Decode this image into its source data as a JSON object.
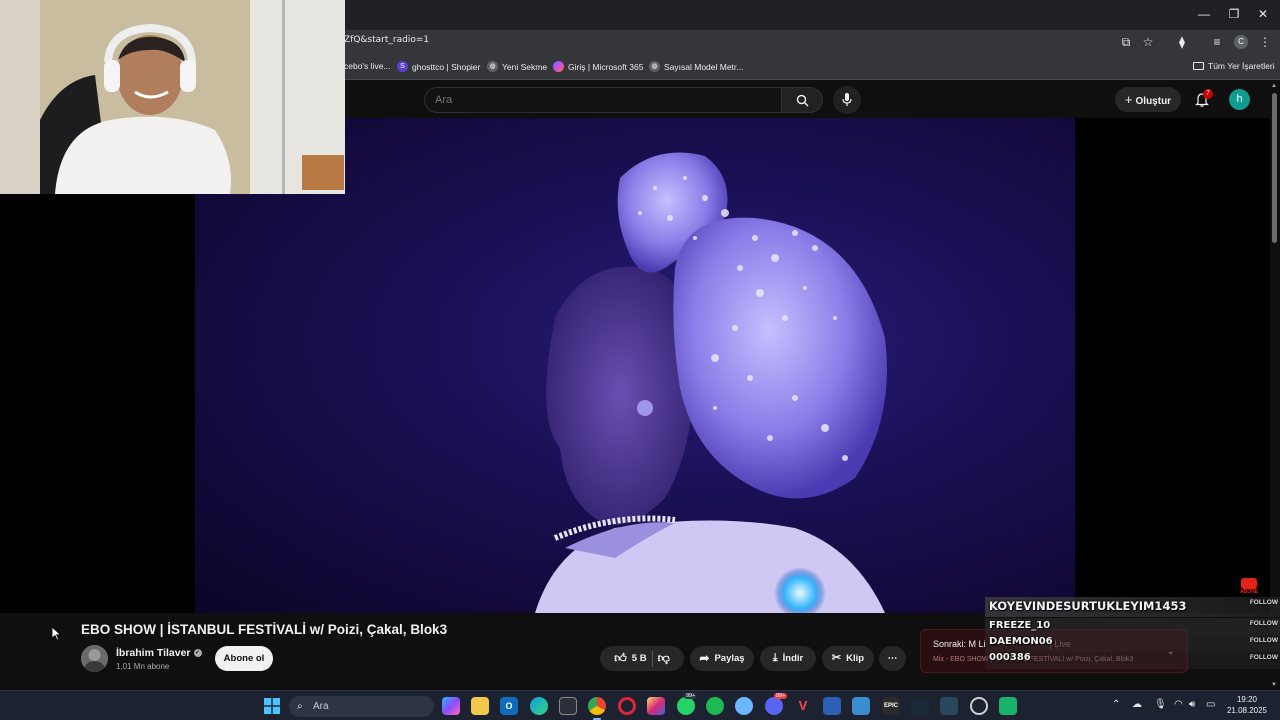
{
  "browser": {
    "url_fragment": "ZfQ&start_radio=1",
    "window_controls": [
      "minimize",
      "maximize",
      "close"
    ],
    "profile_initial": "C"
  },
  "bookmarks": {
    "items": [
      {
        "label": "cebo's live...",
        "icon": "page-icon"
      },
      {
        "label": "ghosttco | Shopier",
        "icon": "shopier-icon",
        "badge": "S"
      },
      {
        "label": "Yeni Sekme",
        "icon": "globe-icon"
      },
      {
        "label": "Giriş | Microsoft 365",
        "icon": "microsoft-365-icon"
      },
      {
        "label": "Sayısal Model Metr...",
        "icon": "globe-icon"
      }
    ],
    "all_bookmarks": "Tüm Yer İşaretleri"
  },
  "youtube": {
    "search_placeholder": "Ara",
    "create_label": "Oluştur",
    "notification_count": "7",
    "avatar_initial": "h"
  },
  "video": {
    "title": "EBO SHOW | İSTANBUL FESTİVALİ w/ Poizi, Çakal, Blok3",
    "channel_name": "İbrahim Tilaver",
    "subscribers": "1,01 Mn abone",
    "subscribe_label": "Abone ol",
    "like_count": "5 B",
    "share_label": "Paylaş",
    "download_label": "İndir",
    "clip_label": "Klip",
    "more_label": "⋯",
    "end_badge": "ABONE"
  },
  "next_up": {
    "line1": "Sonraki: M Li",
    "line1_suffix": "Live",
    "line2": "Mix - EBO SHOW | İSTANBUL FESTİVALİ w/ Poizi, Çakal, Blok3"
  },
  "chat": {
    "rows": [
      {
        "user": "KOYEVINDESURTUKLEYIM1453",
        "action": "FOLLOW"
      },
      {
        "user": "FREEZE_10",
        "action": "FOLLOW"
      },
      {
        "user": "DAEMON06",
        "action": "FOLLOW"
      },
      {
        "user": "000386",
        "action": "FOLLOW"
      }
    ]
  },
  "taskbar": {
    "search_placeholder": "Ara",
    "time": "19:20",
    "date": "21.08.2025",
    "whatsapp_badge": "99+",
    "discord_badge": "99+",
    "apps": [
      "copilot-icon",
      "file-explorer-icon",
      "outlook-icon",
      "edge-icon",
      "store-icon",
      "chrome-icon",
      "opera-icon",
      "instagram-icon",
      "whatsapp-icon",
      "spotify-icon",
      "chat-icon",
      "discord-icon",
      "valorant-icon",
      "teams-icon",
      "photos-icon",
      "epic-games-icon",
      "steam-icon",
      "steam-alt-icon",
      "settings-icon",
      "app-icon"
    ]
  },
  "colors": {
    "youtube_bg": "#0f0f0f",
    "chrome_toolbar": "#35363a",
    "video_tint": "#2a1d7a",
    "taskbar": "#1c2230",
    "next_card": "#2a0d10"
  }
}
